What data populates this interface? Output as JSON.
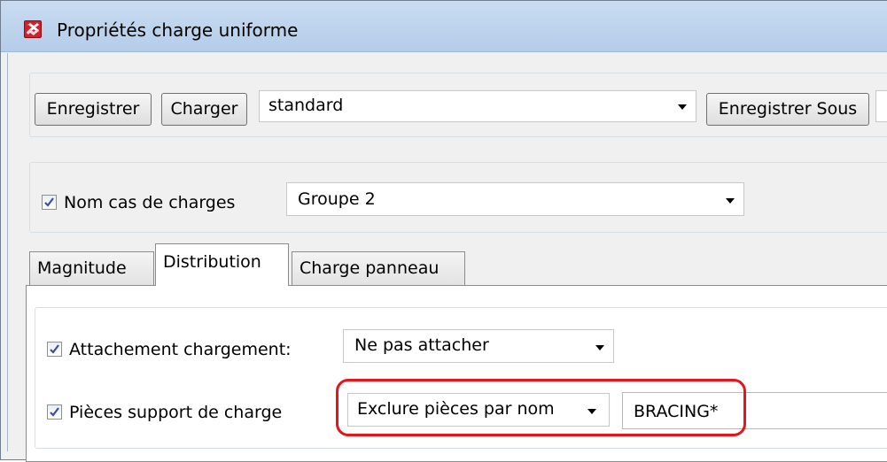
{
  "window": {
    "title": "Propriétés charge uniforme"
  },
  "toolbar": {
    "save_label": "Enregistrer",
    "load_label": "Charger",
    "preset_value": "standard",
    "save_as_label": "Enregistrer Sous"
  },
  "load_case": {
    "checked": true,
    "label": "Nom cas de charges",
    "value": "Groupe 2"
  },
  "tabs": [
    {
      "label": "Magnitude"
    },
    {
      "label": "Distribution"
    },
    {
      "label": "Charge panneau"
    }
  ],
  "active_tab": "Distribution",
  "distribution": {
    "attachment": {
      "checked": true,
      "label": "Attachement chargement:",
      "value": "Ne pas attacher"
    },
    "support_parts": {
      "checked": true,
      "label": "Pièces support de charge",
      "mode_value": "Exclure pièces par nom",
      "filter_value": "BRACING*"
    }
  },
  "colors": {
    "highlight": "#e8141c",
    "titlebar": "#b4cde9",
    "window_bg": "#f0f0f0"
  }
}
